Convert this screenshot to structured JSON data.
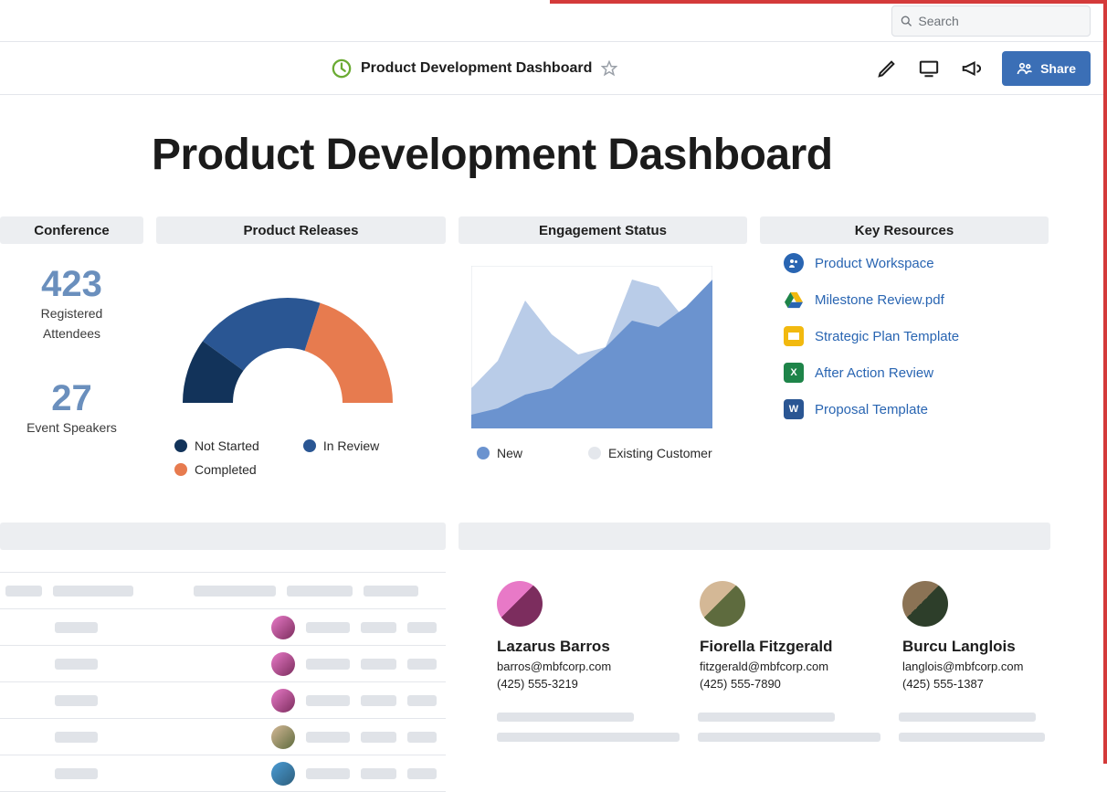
{
  "search": {
    "placeholder": "Search"
  },
  "titlebar": {
    "title": "Product Development Dashboard",
    "share_label": "Share"
  },
  "heading": "Product Development Dashboard",
  "cards": {
    "conference": {
      "title": "Conference",
      "stats": [
        {
          "value": "423",
          "label1": "Registered",
          "label2": "Attendees"
        },
        {
          "value": "27",
          "label1": "Event Speakers"
        }
      ]
    },
    "releases": {
      "title": "Product Releases",
      "legend": [
        {
          "label": "Not Started",
          "color": "#12335a"
        },
        {
          "label": "In Review",
          "color": "#2a5693"
        },
        {
          "label": "Completed",
          "color": "#e77b4f"
        }
      ]
    },
    "engagement": {
      "title": "Engagement Status",
      "legend": [
        {
          "label": "New",
          "color": "#6b93cf"
        },
        {
          "label": "Existing Customer",
          "color": "#e4e7ec"
        }
      ]
    },
    "resources": {
      "title": "Key Resources",
      "items": [
        {
          "label": "Product Workspace",
          "icon": "workspace",
          "color": "#2965b2"
        },
        {
          "label": "Milestone Review.pdf",
          "icon": "drive",
          "color": "#2965b2"
        },
        {
          "label": "Strategic Plan Template",
          "icon": "slides",
          "color": "#f2b90f"
        },
        {
          "label": "After Action Review",
          "icon": "excel",
          "color": "#1e8449"
        },
        {
          "label": "Proposal Template",
          "icon": "word",
          "color": "#2a5693"
        }
      ]
    }
  },
  "contacts": [
    {
      "name": "Lazarus Barros",
      "email": "barros@mbfcorp.com",
      "phone": "(425) 555-3219"
    },
    {
      "name": "Fiorella Fitzgerald",
      "email": "fitzgerald@mbfcorp.com",
      "phone": "(425) 555-7890"
    },
    {
      "name": "Burcu Langlois",
      "email": "langlois@mbfcorp.com",
      "phone": "(425) 555-1387"
    }
  ],
  "chart_data": [
    {
      "type": "pie",
      "title": "Product Releases",
      "categories": [
        "Not Started",
        "In Review",
        "Completed"
      ],
      "values": [
        20,
        40,
        40
      ],
      "colors": [
        "#12335a",
        "#2a5693",
        "#e77b4f"
      ],
      "note": "rendered as half donut"
    },
    {
      "type": "area",
      "title": "Engagement Status",
      "x": [
        0,
        1,
        2,
        3,
        4,
        5,
        6,
        7,
        8,
        9
      ],
      "series": [
        {
          "name": "New",
          "values": [
            30,
            50,
            95,
            70,
            55,
            60,
            110,
            105,
            80,
            60
          ],
          "color": "#b9cce8"
        },
        {
          "name": "Existing Customer",
          "values": [
            10,
            15,
            25,
            30,
            45,
            60,
            80,
            75,
            90,
            110
          ],
          "color": "#6b93cf"
        }
      ],
      "ylim": [
        0,
        120
      ]
    }
  ]
}
